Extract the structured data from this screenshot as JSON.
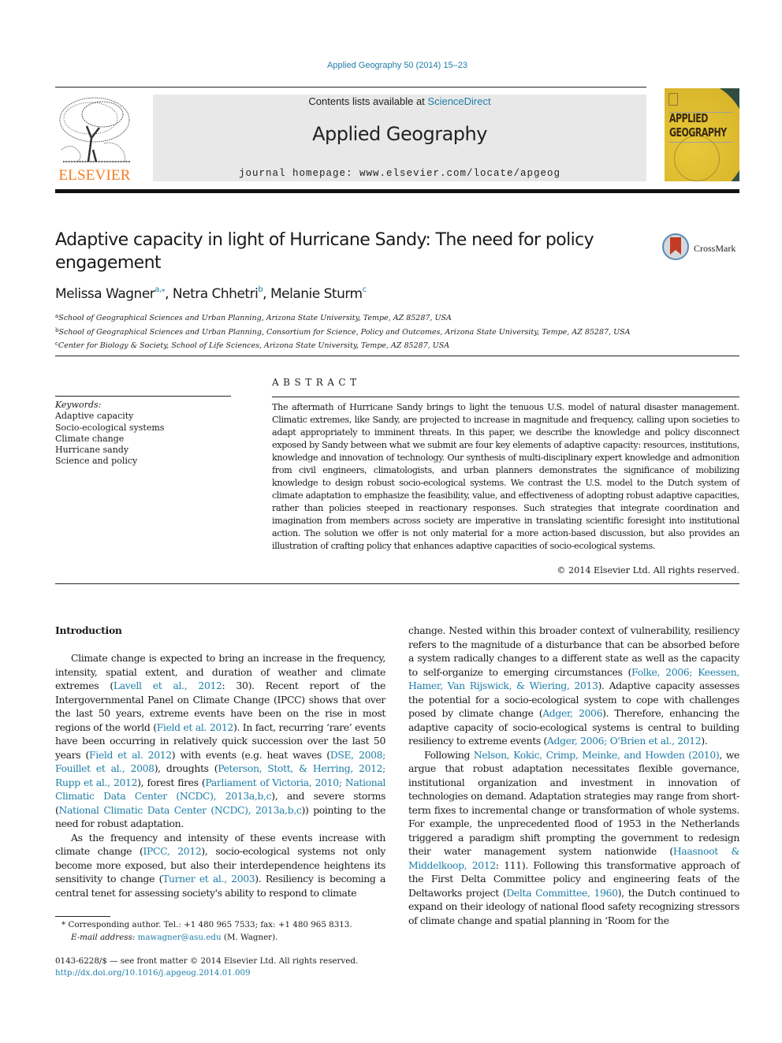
{
  "header": {
    "journal_ref": "Applied Geography 50 (2014) 15–23",
    "contents_prefix": "Contents lists available at ",
    "contents_link": "ScienceDirect",
    "journal_title": "Applied Geography",
    "homepage_prefix": "journal homepage: ",
    "homepage_url": "www.elsevier.com/locate/apgeog",
    "publisher_logo_text": "ELSEVIER",
    "cover_title_line1": "APPLIED",
    "cover_title_line2": "GEOGRAPHY",
    "colors": {
      "link": "#1f7ea8",
      "elsevier_orange": "#f47c20",
      "banner_bg": "#e8e8e8"
    }
  },
  "article": {
    "title": "Adaptive capacity in light of Hurricane Sandy: The need for policy engagement",
    "crossmark_label": "CrossMark",
    "authors": [
      {
        "name": "Melissa Wagner",
        "sup": "a,⁎"
      },
      {
        "name": "Netra Chhetri",
        "sup": "b"
      },
      {
        "name": "Melanie Sturm",
        "sup": "c"
      }
    ],
    "affiliations": [
      {
        "mark": "a",
        "text": "School of Geographical Sciences and Urban Planning, Arizona State University, Tempe, AZ 85287, USA"
      },
      {
        "mark": "b",
        "text": "School of Geographical Sciences and Urban Planning, Consortium for Science, Policy and Outcomes, Arizona State University, Tempe, AZ 85287, USA"
      },
      {
        "mark": "c",
        "text": "Center for Biology & Society, School of Life Sciences, Arizona State University, Tempe, AZ 85287, USA"
      }
    ]
  },
  "keywords": {
    "label": "Keywords:",
    "items": [
      "Adaptive capacity",
      "Socio-ecological systems",
      "Climate change",
      "Hurricane sandy",
      "Science and policy"
    ]
  },
  "abstract": {
    "heading": "ABSTRACT",
    "text": "The aftermath of Hurricane Sandy brings to light the tenuous U.S. model of natural disaster management. Climatic extremes, like Sandy, are projected to increase in magnitude and frequency, calling upon societies to adapt appropriately to imminent threats. In this paper, we describe the knowledge and policy disconnect exposed by Sandy between what we submit are four key elements of adaptive capacity: resources, institutions, knowledge and innovation of technology. Our synthesis of multi-disciplinary expert knowledge and admonition from civil engineers, climatologists, and urban planners demonstrates the significance of mobilizing knowledge to design robust socio-ecological systems. We contrast the U.S. model to the Dutch system of climate adaptation to emphasize the feasibility, value, and effectiveness of adopting robust adaptive capacities, rather than policies steeped in reactionary responses. Such strategies that integrate coordination and imagination from members across society are imperative in translating scientific foresight into institutional action. The solution we offer is not only material for a more action-based discussion, but also provides an illustration of crafting policy that enhances adaptive capacities of socio-ecological systems.",
    "copyright": "© 2014 Elsevier Ltd. All rights reserved."
  },
  "body": {
    "section_heading": "Introduction",
    "left_paragraphs": [
      [
        {
          "t": "Climate change is expected to bring an increase in the frequency, intensity, spatial extent, and duration of weather and climate extremes ("
        },
        {
          "t": "Lavell et al., 2012",
          "link": true
        },
        {
          "t": ": 30). Recent report of the Intergovernmental Panel on Climate Change (IPCC) shows that over the last 50 years, extreme events have been on the rise in most regions of the world ("
        },
        {
          "t": "Field et al. 2012",
          "link": true
        },
        {
          "t": "). In fact, recurring ‘rare’ events have been occurring in relatively quick succession over the last 50 years ("
        },
        {
          "t": "Field et al. 2012",
          "link": true
        },
        {
          "t": ") with events (e.g. heat waves ("
        },
        {
          "t": "DSE, 2008; Fouillet et al., 2008",
          "link": true
        },
        {
          "t": "), droughts ("
        },
        {
          "t": "Peterson, Stott, & Herring, 2012; Rupp et al., 2012",
          "link": true
        },
        {
          "t": "), forest fires ("
        },
        {
          "t": "Parliament of Victoria, 2010; National Climatic Data Center (NCDC), 2013a,b,c",
          "link": true
        },
        {
          "t": "), and severe storms ("
        },
        {
          "t": "National Climatic Data Center (NCDC), 2013a,b,c",
          "link": true
        },
        {
          "t": ")) pointing to the need for robust adaptation."
        }
      ],
      [
        {
          "t": "As the frequency and intensity of these events increase with climate change ("
        },
        {
          "t": "IPCC, 2012",
          "link": true
        },
        {
          "t": "), socio-ecological systems not only become more exposed, but also their interdependence heightens its sensitivity to change ("
        },
        {
          "t": "Turner et al., 2003",
          "link": true
        },
        {
          "t": "). Resiliency is becoming a central tenet for assessing society's ability to respond to climate"
        }
      ]
    ],
    "right_paragraphs": [
      [
        {
          "t": "change. Nested within this broader context of vulnerability, resiliency refers to the magnitude of a disturbance that can be absorbed before a system radically changes to a different state as well as the capacity to self-organize to emerging circumstances ("
        },
        {
          "t": "Folke, 2006; Keessen, Hamer, Van Rijswick, & Wiering, 2013",
          "link": true
        },
        {
          "t": "). Adaptive capacity assesses the potential for a socio-ecological system to cope with challenges posed by climate change ("
        },
        {
          "t": "Adger, 2006",
          "link": true
        },
        {
          "t": "). Therefore, enhancing the adaptive capacity of socio-ecological systems is central to building resiliency to extreme events ("
        },
        {
          "t": "Adger, 2006; O'Brien et al., 2012",
          "link": true
        },
        {
          "t": ")."
        }
      ],
      [
        {
          "t": "Following "
        },
        {
          "t": "Nelson, Kokic, Crimp, Meinke, and Howden (2010)",
          "link": true
        },
        {
          "t": ", we argue that robust adaptation necessitates flexible governance, institutional organization and investment in innovation of technologies on demand. Adaptation strategies may range from short-term fixes to incremental change or transformation of whole systems. For example, the unprecedented flood of 1953 in the Netherlands triggered a paradigm shift prompting the government to redesign their water management system nationwide ("
        },
        {
          "t": "Haasnoot & Middelkoop, 2012",
          "link": true
        },
        {
          "t": ": 111). Following this transformative approach of the First Delta Committee policy and engineering feats of the Deltaworks project ("
        },
        {
          "t": "Delta Committee, 1960",
          "link": true
        },
        {
          "t": "), the Dutch continued to expand on their ideology of national flood safety recognizing stressors of climate change and spatial planning in ‘Room for the"
        }
      ]
    ]
  },
  "footnotes": {
    "corresponding_mark": "*",
    "corresponding_text": "Corresponding author. Tel.: +1 480 965 7533; fax: +1 480 965 8313.",
    "email_label": "E-mail address:",
    "email": "mawagner@asu.edu",
    "email_suffix": " (M. Wagner).",
    "issn_line": "0143-6228/$ — see front matter © 2014 Elsevier Ltd. All rights reserved.",
    "doi": "http://dx.doi.org/10.1016/j.apgeog.2014.01.009"
  }
}
